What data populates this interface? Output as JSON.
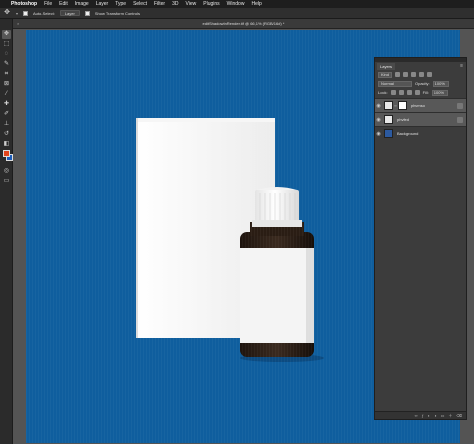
{
  "menubar": {
    "app_name": "Photoshop",
    "items": [
      "File",
      "Edit",
      "Image",
      "Layer",
      "Type",
      "Select",
      "Filter",
      "3D",
      "View",
      "Plugins",
      "Window",
      "Help"
    ]
  },
  "options_bar": {
    "auto_select_label": "Auto-Select:",
    "auto_select_value": "Layer",
    "transform_label": "Show Transform Controls"
  },
  "document": {
    "tab_title": "editShadowInRender.tif @ 66,1% (RGB/16#) *"
  },
  "colors": {
    "foreground": "#e2451d",
    "background": "#1c5cb8",
    "canvas": "#0f5e9e"
  },
  "layers_panel": {
    "tab_label": "Layers",
    "filter_label": "Kind",
    "blend_mode": "Normal",
    "opacity_label": "Opacity:",
    "opacity_value": "100%",
    "lock_label": "Lock:",
    "fill_label": "Fill:",
    "fill_value": "100%",
    "layers": [
      {
        "name": "phvmso",
        "thumb": "white",
        "has_mask": true,
        "selected": true
      },
      {
        "name": "phvfed",
        "thumb": "white",
        "has_mask": false,
        "selected": false
      },
      {
        "name": "Background",
        "thumb": "blue",
        "has_mask": false,
        "selected": false
      }
    ]
  }
}
